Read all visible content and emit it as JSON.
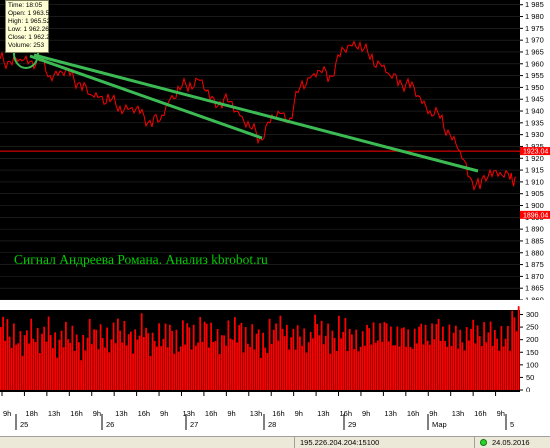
{
  "tooltip": {
    "lines": [
      "Time: 18:05",
      "Open: 1 963.5",
      "High: 1 965.52",
      "Low: 1 962.26",
      "Close: 1 962.29",
      "Volume: 253"
    ]
  },
  "watermark": "Сигнал Андреева Романа. Анализ kbrobot.ru",
  "price_axis": {
    "ticks": [
      "1 985",
      "1 980",
      "1 975",
      "1 970",
      "1 965",
      "1 960",
      "1 955",
      "1 950",
      "1 945",
      "1 940",
      "1 935",
      "1 930",
      "1 925",
      "1 920",
      "1 915",
      "1 910",
      "1 905",
      "1 900",
      "1 895",
      "1 890",
      "1 885",
      "1 880",
      "1 875",
      "1 870",
      "1 865",
      "1 860"
    ],
    "current_label": "1923.04",
    "lower_label": "1896.04",
    "range": [
      1860,
      1987
    ]
  },
  "volume_axis": {
    "ticks": [
      "300",
      "250",
      "200",
      "150",
      "100",
      "50",
      "0"
    ],
    "range": [
      0,
      310
    ]
  },
  "time_axis": {
    "hour_labels": [
      "9h",
      "18h",
      "13h",
      "16h",
      "9h",
      "13h",
      "16h",
      "9h",
      "13h",
      "16h",
      "9h",
      "13h",
      "16h",
      "9h",
      "13h",
      "16h",
      "9h",
      "13h",
      "16h",
      "9h",
      "13h",
      "16h",
      "9h"
    ],
    "day_labels": [
      "25",
      "26",
      "27",
      "28",
      "29",
      "Мар",
      "5"
    ]
  },
  "status": {
    "connection": "195.226.204.204:15100",
    "date": "24.05.2016"
  },
  "colors": {
    "background": "#000000",
    "price_line": "#ff0000",
    "volume_bars": "#ff0000",
    "trend_lines": "#3cba54",
    "watermark": "#00cc00",
    "grid": "#3a3a3a",
    "level_line": "#ff0000"
  },
  "chart_data": [
    {
      "type": "line",
      "title": "",
      "x": [
        0,
        10,
        20,
        30,
        40,
        50,
        60,
        70,
        80,
        90,
        100,
        110,
        120,
        130,
        140,
        150,
        160,
        170,
        180,
        190,
        200,
        210,
        220,
        230,
        240,
        250,
        260,
        270,
        280,
        290,
        300,
        310,
        320,
        330,
        340,
        350,
        360,
        370,
        380,
        390,
        400,
        410,
        420,
        430,
        440,
        450,
        460,
        470,
        480,
        490,
        500,
        510,
        516
      ],
      "values": [
        1962,
        1961,
        1962,
        1961,
        1961,
        1955,
        1957,
        1955,
        1952,
        1947,
        1946,
        1944,
        1942,
        1941,
        1939,
        1936,
        1936,
        1945,
        1949,
        1952,
        1953,
        1945,
        1944,
        1944,
        1938,
        1933,
        1929,
        1935,
        1939,
        1937,
        1950,
        1954,
        1957,
        1955,
        1963,
        1968,
        1969,
        1962,
        1960,
        1955,
        1953,
        1950,
        1946,
        1940,
        1937,
        1930,
        1923,
        1912,
        1907,
        1915,
        1914,
        1911,
        1912
      ],
      "level": 1923.04,
      "ylim": [
        1860,
        1987
      ],
      "grid": true
    },
    {
      "type": "bar",
      "title": "",
      "values": [
        250,
        210,
        190,
        230,
        200,
        240,
        180,
        220,
        205,
        170,
        230,
        215,
        195,
        240,
        220,
        200,
        250,
        190,
        210,
        225,
        185,
        235,
        205,
        245,
        215,
        195,
        225,
        240,
        200,
        210,
        180,
        230,
        250,
        205,
        215,
        190,
        260,
        220,
        200,
        240,
        210,
        185,
        230,
        215,
        245,
        200,
        225,
        190,
        235,
        210,
        250,
        205,
        220,
        195,
        240,
        215,
        230,
        200,
        210,
        280
      ],
      "ylim": [
        0,
        310
      ]
    }
  ]
}
